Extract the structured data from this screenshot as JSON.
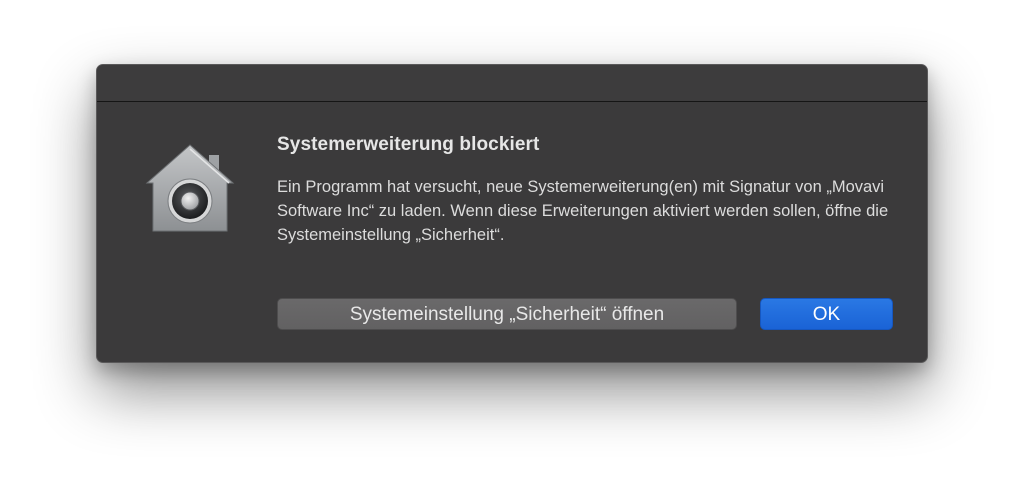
{
  "dialog": {
    "icon": "security-lock-house-icon",
    "title": "Systemerweiterung blockiert",
    "message": "Ein Programm hat versucht, neue Systemerweiterung(en) mit Signatur von „Movavi Software Inc“ zu laden. Wenn diese Erweiterungen aktiviert werden sollen, öffne die Systemeinstellung „Sicherheit“.",
    "secondary_button": "Systemeinstellung „Sicherheit“ öffnen",
    "primary_button": "OK"
  },
  "colors": {
    "dialog_background": "#3b3a3b",
    "primary_button": "#1f6bdc",
    "secondary_button": "#656465",
    "text": "#e6e6e6"
  }
}
